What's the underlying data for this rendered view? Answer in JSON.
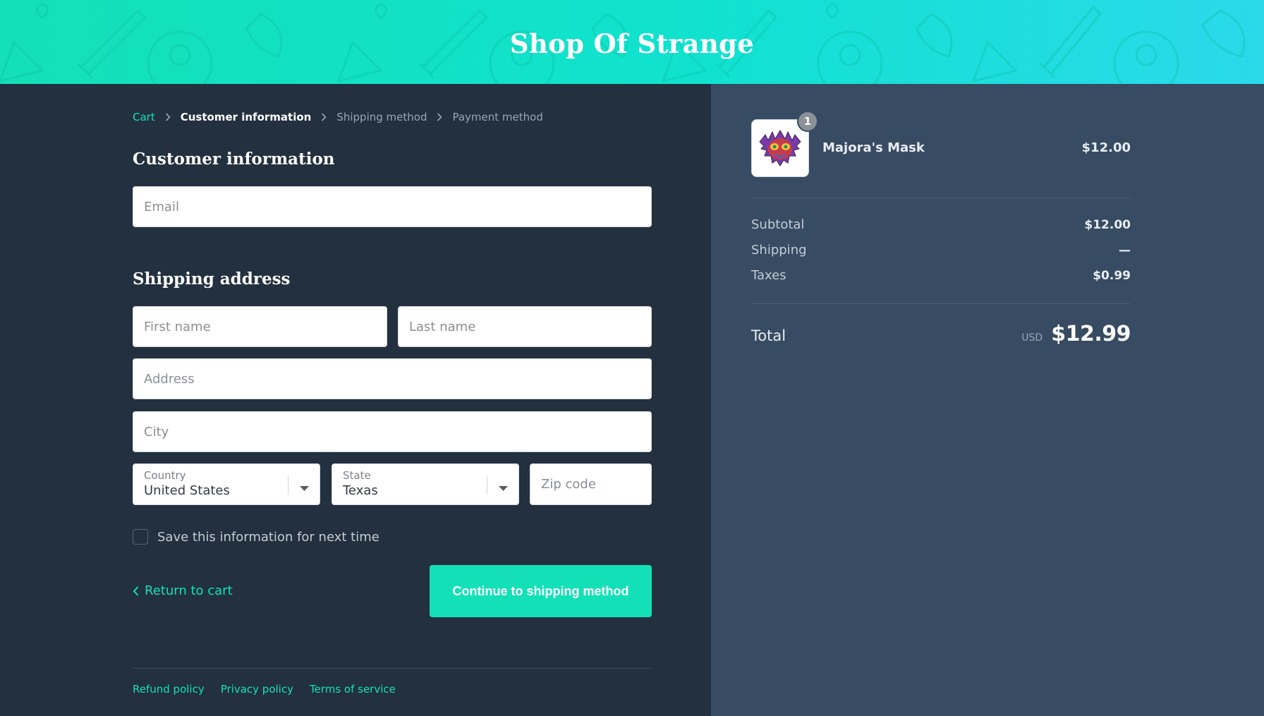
{
  "header": {
    "shop_name": "Shop Of Strange"
  },
  "breadcrumb": {
    "cart": "Cart",
    "customer_information": "Customer information",
    "shipping_method": "Shipping method",
    "payment_method": "Payment method"
  },
  "form": {
    "customer_title": "Customer information",
    "email_placeholder": "Email",
    "shipping_title": "Shipping address",
    "first_name_placeholder": "First name",
    "last_name_placeholder": "Last name",
    "address_placeholder": "Address",
    "city_placeholder": "City",
    "country_label": "Country",
    "country_value": "United States",
    "state_label": "State",
    "state_value": "Texas",
    "zip_placeholder": "Zip code",
    "save_info_label": "Save this information for next time",
    "return_label": "Return to cart",
    "continue_label": "Continue to shipping method"
  },
  "footer": {
    "refund": "Refund policy",
    "privacy": "Privacy policy",
    "terms": "Terms of service"
  },
  "order": {
    "item": {
      "name": "Majora's Mask",
      "price": "$12.00",
      "quantity": "1"
    },
    "subtotal_label": "Subtotal",
    "subtotal_value": "$12.00",
    "shipping_label": "Shipping",
    "shipping_value": "—",
    "taxes_label": "Taxes",
    "taxes_value": "$0.99",
    "total_label": "Total",
    "currency": "USD",
    "total_value": "$12.99"
  },
  "colors": {
    "accent": "#14e0b7",
    "main_bg": "#22303f",
    "sidebar_bg": "#374b62"
  }
}
